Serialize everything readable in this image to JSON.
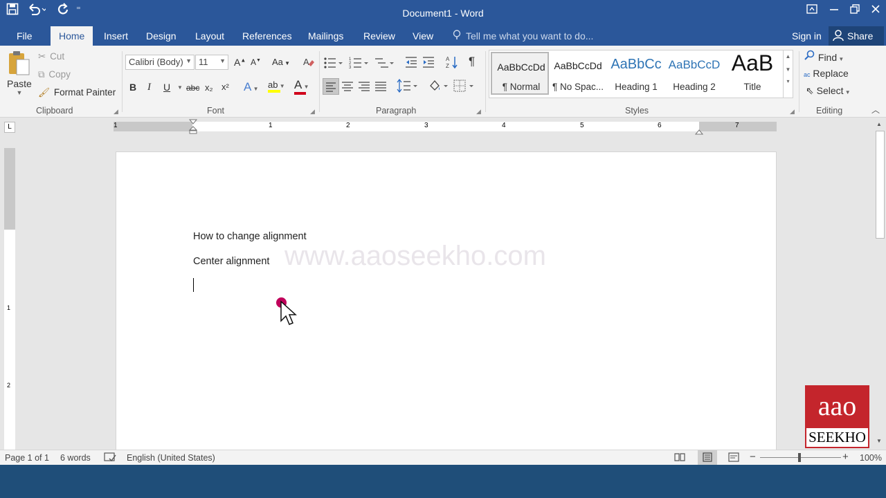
{
  "titlebar": {
    "title": "Document1 - Word",
    "qat_more": "⁼"
  },
  "tabs": [
    {
      "label": "File"
    },
    {
      "label": "Home"
    },
    {
      "label": "Insert"
    },
    {
      "label": "Design"
    },
    {
      "label": "Layout"
    },
    {
      "label": "References"
    },
    {
      "label": "Mailings"
    },
    {
      "label": "Review"
    },
    {
      "label": "View"
    }
  ],
  "tell_me": "Tell me what you want to do...",
  "sign_in": "Sign in",
  "share": "Share",
  "clipboard": {
    "paste": "Paste",
    "cut": "Cut",
    "copy": "Copy",
    "format_painter": "Format Painter",
    "group_label": "Clipboard"
  },
  "font": {
    "font_name": "Calibri (Body)",
    "font_size": "11",
    "grow": "A",
    "shrink": "A",
    "case": "Aa",
    "bold": "B",
    "italic": "I",
    "underline": "U",
    "strike": "abc",
    "subscript": "x₂",
    "superscript": "x²",
    "text_effects": "A",
    "highlight": "ab",
    "font_color": "A",
    "group_label": "Font"
  },
  "paragraph": {
    "group_label": "Paragraph",
    "pilcrow": "¶"
  },
  "styles": {
    "items": [
      {
        "preview": "AaBbCcDd",
        "label": "¶ Normal"
      },
      {
        "preview": "AaBbCcDd",
        "label": "¶ No Spac..."
      },
      {
        "preview": "AaBbCc",
        "label": "Heading 1"
      },
      {
        "preview": "AaBbCcD",
        "label": "Heading 2"
      },
      {
        "preview": "AaB",
        "label": "Title"
      }
    ],
    "group_label": "Styles"
  },
  "editing": {
    "find": "Find",
    "replace": "Replace",
    "select": "Select",
    "group_label": "Editing",
    "replace_icon_text": "ac"
  },
  "ruler": {
    "corner": "L",
    "numbers": [
      "1",
      "1",
      "2",
      "3",
      "4",
      "5",
      "6",
      "7"
    ],
    "vnumbers": [
      "1",
      "1",
      "2"
    ]
  },
  "document": {
    "lines": [
      "How to change alignment",
      "Center alignment"
    ],
    "watermark": "www.aaoseekho.com"
  },
  "status": {
    "page": "Page 1 of 1",
    "words": "6 words",
    "language": "English (United States)",
    "zoom_minus": "−",
    "zoom_plus": "+",
    "zoom": "100%"
  },
  "logo": {
    "top": "aao",
    "bottom": "SEEKHO"
  },
  "colors": {
    "title_bar": "#2b579a",
    "bottom_band": "#1f4e79",
    "logo_red": "#c4252c",
    "cursor_dot": "#c0005a",
    "font_color_bar": "#d0021b",
    "highlight_bar": "#ffff00"
  }
}
